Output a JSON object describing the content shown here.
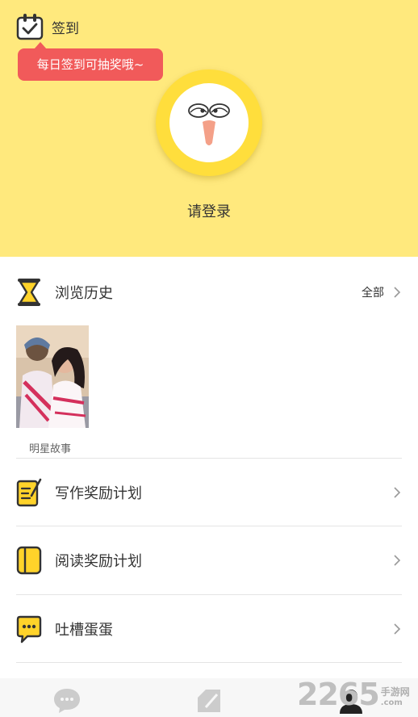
{
  "header": {
    "checkin_label": "签到",
    "checkin_tip": "每日签到可抽奖哦~",
    "login_label": "请登录"
  },
  "history": {
    "title": "浏览历史",
    "all_label": "全部",
    "items": [
      {
        "caption": "明星故事"
      }
    ]
  },
  "menu": [
    {
      "label": "写作奖励计划",
      "icon": "pen-note-icon"
    },
    {
      "label": "阅读奖励计划",
      "icon": "book-icon"
    },
    {
      "label": "吐槽蛋蛋",
      "icon": "chat-bubble-icon"
    }
  ],
  "tabbar": {
    "tabs": [
      {
        "icon": "chat-icon"
      },
      {
        "icon": "edit-icon"
      },
      {
        "icon": "profile-icon"
      }
    ]
  },
  "watermark": {
    "number": "2265",
    "cn": "手游网",
    "domain": ".com"
  },
  "colors": {
    "header_bg": "#ffe97d",
    "accent_yellow": "#ffde3c",
    "tip_red": "#f15a5a"
  }
}
